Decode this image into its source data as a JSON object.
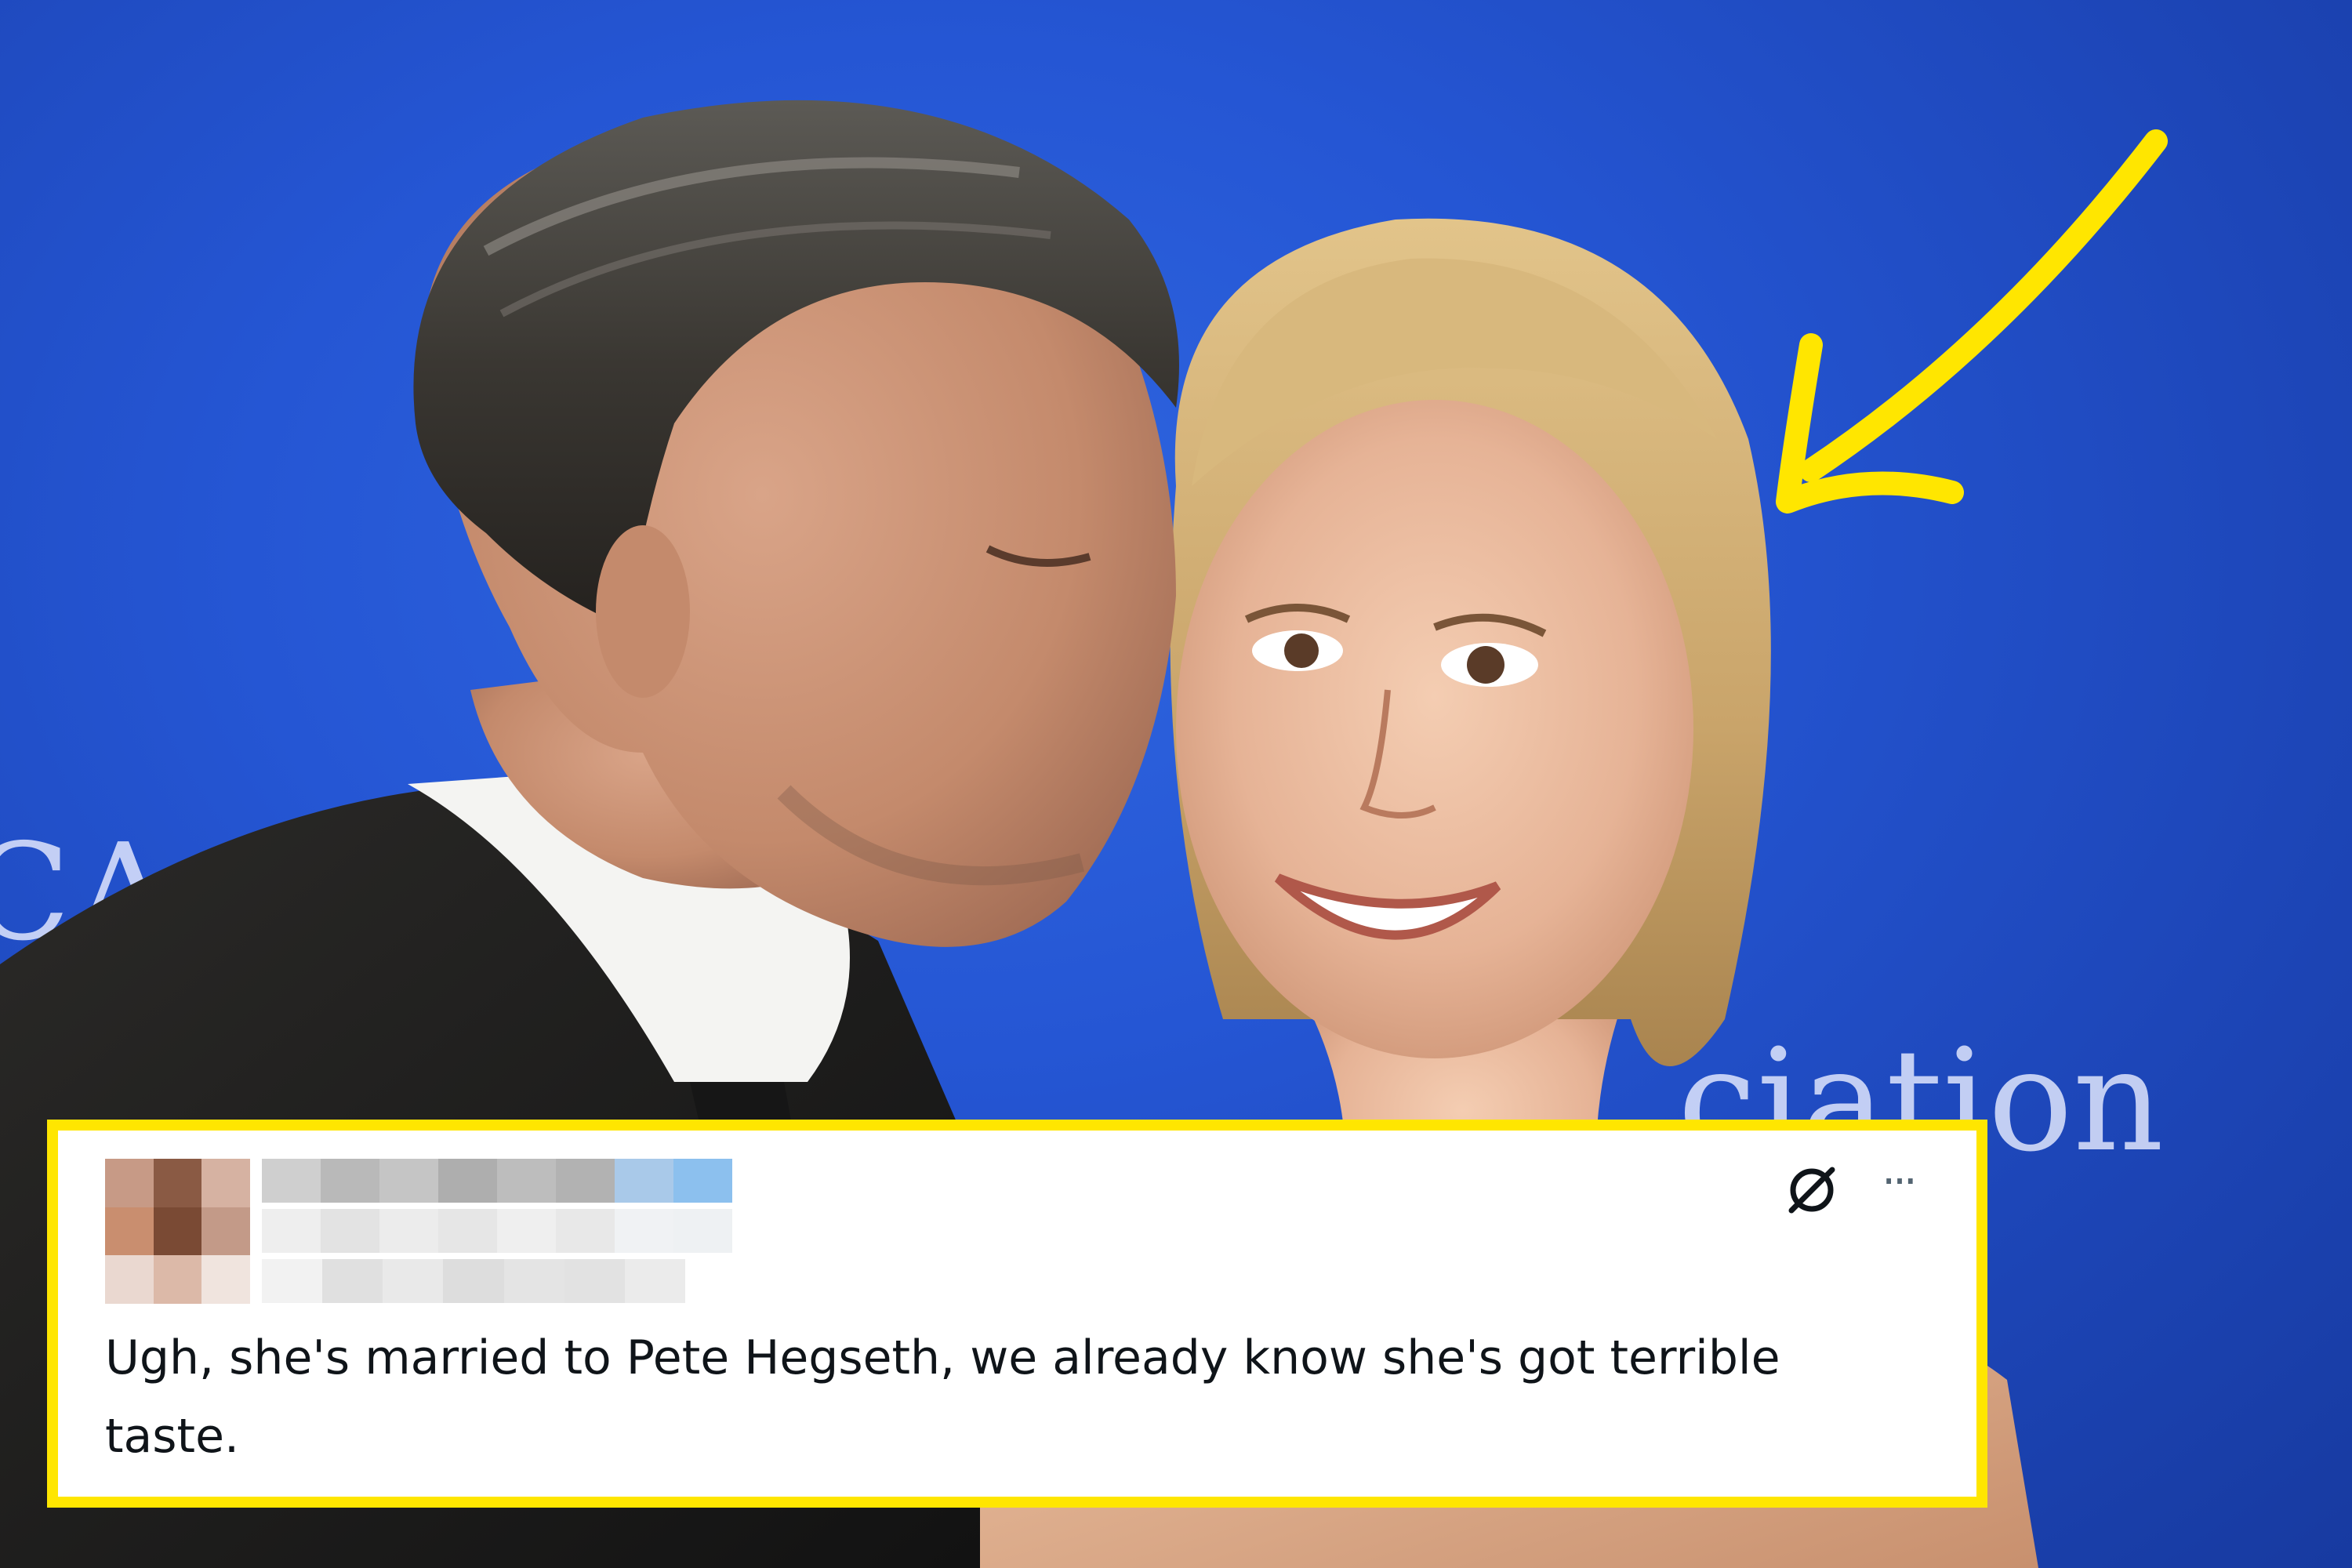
{
  "photo": {
    "backdrop_text_left": "CA",
    "backdrop_text_right": "ciation",
    "highlight_color": "#ffe600",
    "backdrop_color": "#2556d4"
  },
  "tweet": {
    "author_name": "",
    "author_handle": "",
    "body": "Ugh, she's married to Pete Hegseth, we already know she's got terrible taste.",
    "icons": [
      "no-symbol-icon",
      "more-options-icon"
    ],
    "more_label": "···"
  }
}
